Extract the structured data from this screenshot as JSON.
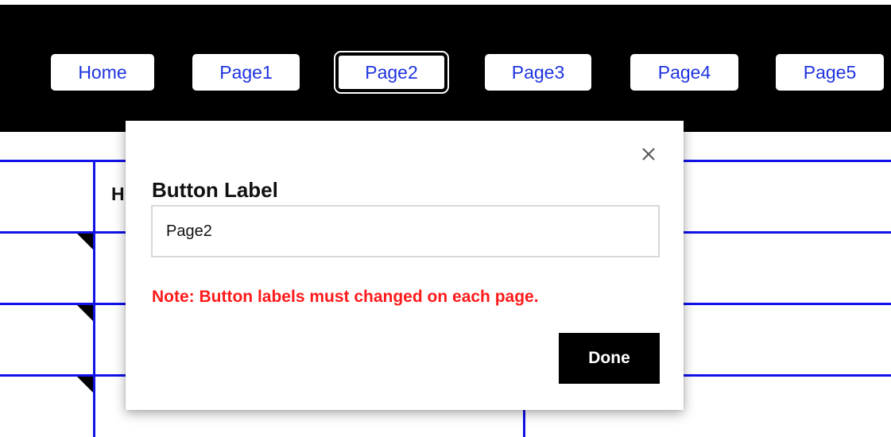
{
  "nav": {
    "buttons": [
      {
        "label": "Home"
      },
      {
        "label": "Page1"
      },
      {
        "label": "Page2"
      },
      {
        "label": "Page3"
      },
      {
        "label": "Page4"
      },
      {
        "label": "Page5"
      }
    ],
    "selected": "Page2"
  },
  "background": {
    "heading_partial": "H"
  },
  "modal": {
    "label": "Button Label",
    "input_value": "Page2",
    "note": "Note: Button labels must changed on each page.",
    "done_label": "Done",
    "close_icon": "close-icon"
  },
  "colors": {
    "topbar": "#000000",
    "nav_text": "#1d33e0",
    "grid_lines": "#1111e8",
    "note_text": "#ff1a1a",
    "done_bg": "#000000"
  }
}
